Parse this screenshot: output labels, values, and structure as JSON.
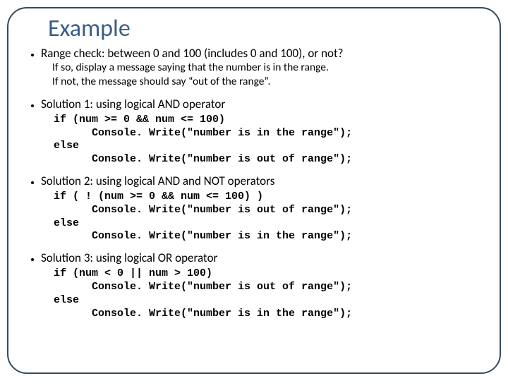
{
  "title": "Example",
  "b1": {
    "head": "Range check: between 0 and 100 (includes 0 and 100), or not?",
    "sub1": "If so, display a message saying that the number is in the range.",
    "sub2": "If not, the message should say “out of the range”."
  },
  "b2": {
    "head": "Solution 1: using logical AND operator",
    "code": "if (num >= 0 && num <= 100)\n      Console. Write(\"number is in the range\");\nelse\n      Console. Write(\"number is out of range\");"
  },
  "b3": {
    "head": "Solution 2: using logical AND and NOT operators",
    "code": "if ( ! (num >= 0 && num <= 100) )\n      Console. Write(\"number is out of range\");\nelse\n      Console. Write(\"number is in the range\");"
  },
  "b4": {
    "head": "Solution 3: using logical OR operator",
    "code": "if (num < 0 || num > 100)\n      Console. Write(\"number is out of range\");\nelse\n      Console. Write(\"number is in the range\");"
  }
}
